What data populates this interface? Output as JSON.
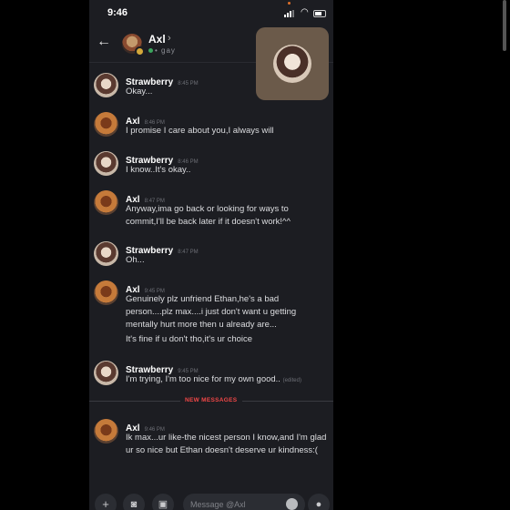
{
  "status": {
    "time": "9:46"
  },
  "header": {
    "name": "Axl",
    "chevron": "›",
    "subtitle": "gay"
  },
  "messages": [
    {
      "author": "Strawberry",
      "time": "8:45 PM",
      "avatar": "strawberry",
      "text": "Okay..."
    },
    {
      "author": "Axl",
      "time": "8:46 PM",
      "avatar": "axl",
      "text": "I promise I care about you,I always will"
    },
    {
      "author": "Strawberry",
      "time": "8:46 PM",
      "avatar": "strawberry",
      "text": "I know..It's okay.."
    },
    {
      "author": "Axl",
      "time": "8:47 PM",
      "avatar": "axl",
      "text": "Anyway,ima go back or looking for ways to commit,I'll be back later if it doesn't work!^^"
    },
    {
      "author": "Strawberry",
      "time": "8:47 PM",
      "avatar": "strawberry",
      "text": "Oh..."
    },
    {
      "author": "Axl",
      "time": "9:45 PM",
      "avatar": "axl",
      "text": "Genuinely plz unfriend Ethan,he's a bad person....plz max....i just don't want u getting mentally hurt more then u already are...",
      "text2": "It's fine if u don't tho,it's ur choice"
    },
    {
      "author": "Strawberry",
      "time": "9:45 PM",
      "avatar": "strawberry",
      "text": "I'm trying, I'm too nice for my own good..",
      "edited": "(edited)"
    },
    {
      "author": "Axl",
      "time": "9:46 PM",
      "avatar": "axl",
      "text": "Ik max...ur like-the nicest person I know,and I'm glad ur so nice but Ethan doesn't deserve ur kindness:("
    }
  ],
  "divider": {
    "label": "NEW MESSAGES"
  },
  "composer": {
    "placeholder": "Message @Axl"
  },
  "colors": {
    "background": "#1c1d22",
    "new_messages": "#f04747",
    "online": "#3ba55d"
  }
}
